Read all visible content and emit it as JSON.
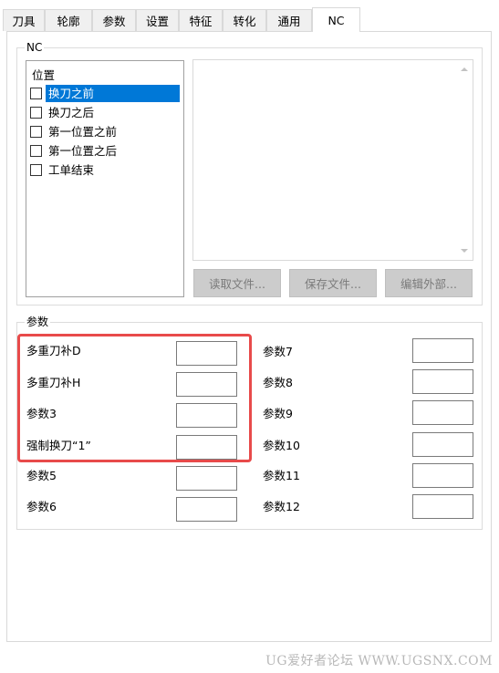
{
  "tabs": [
    {
      "label": "刀具"
    },
    {
      "label": "轮廓"
    },
    {
      "label": "参数"
    },
    {
      "label": "设置"
    },
    {
      "label": "特征"
    },
    {
      "label": "转化"
    },
    {
      "label": "通用"
    },
    {
      "label": "NC"
    }
  ],
  "active_tab": "NC",
  "nc_group": {
    "title": "NC",
    "list_header": "位置",
    "items": [
      {
        "label": "换刀之前",
        "checked": false,
        "selected": true
      },
      {
        "label": "换刀之后",
        "checked": false,
        "selected": false
      },
      {
        "label": "第一位置之前",
        "checked": false,
        "selected": false
      },
      {
        "label": "第一位置之后",
        "checked": false,
        "selected": false
      },
      {
        "label": "工单结束",
        "checked": false,
        "selected": false
      }
    ],
    "editor_value": "",
    "buttons": {
      "read_file": "读取文件...",
      "save_file": "保存文件...",
      "edit_external": "编辑外部..."
    }
  },
  "params_group": {
    "title": "参数",
    "left": [
      {
        "label": "多重刀补D",
        "value": ""
      },
      {
        "label": "多重刀补H",
        "value": ""
      },
      {
        "label": "参数3",
        "value": ""
      },
      {
        "label": "强制换刀“1”",
        "value": ""
      },
      {
        "label": "参数5",
        "value": ""
      },
      {
        "label": "参数6",
        "value": ""
      }
    ],
    "right": [
      {
        "label": "参数7",
        "value": ""
      },
      {
        "label": "参数8",
        "value": ""
      },
      {
        "label": "参数9",
        "value": ""
      },
      {
        "label": "参数10",
        "value": ""
      },
      {
        "label": "参数11",
        "value": ""
      },
      {
        "label": "参数12",
        "value": ""
      }
    ]
  },
  "highlight_color": "#e84a4a",
  "selection_color": "#0078d7",
  "watermark": "UG爱好者论坛 WWW.UGSNX.COM"
}
